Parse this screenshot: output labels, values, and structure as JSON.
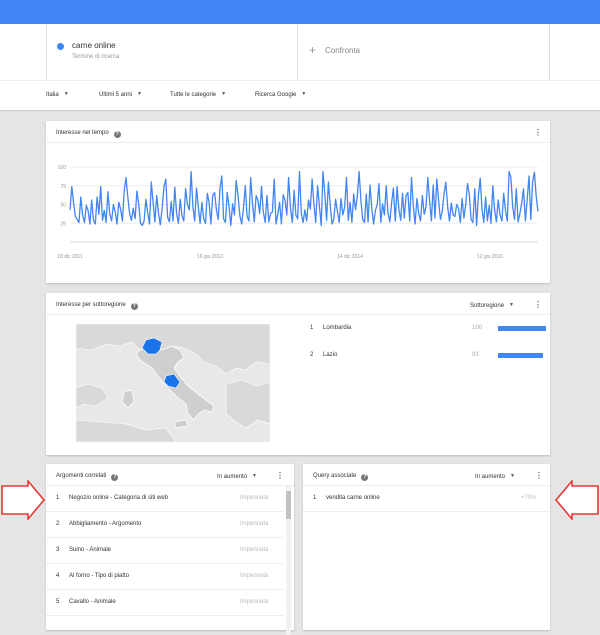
{
  "header": {
    "color": "#4285f4"
  },
  "search": {
    "term": "carne online",
    "term_type": "Termine di ricerca",
    "term_color": "#4285f4",
    "compare_label": "Confronta"
  },
  "filters": [
    {
      "label": "Italia"
    },
    {
      "label": "Ultimi 5 anni"
    },
    {
      "label": "Tutte le categorie"
    },
    {
      "label": "Ricerca Google"
    }
  ],
  "interest_over_time": {
    "title": "Interesse nel tempo",
    "help_icon": "help-icon",
    "menu_icon": "more-vert-icon"
  },
  "chart_data": {
    "type": "line",
    "title": "Interesse nel tempo",
    "xlabel": "",
    "ylabel": "",
    "ylim": [
      0,
      100
    ],
    "yticks": [
      25,
      50,
      75,
      100
    ],
    "x_tick_labels": [
      "18 dic 2011",
      "16 giu 2013",
      "14 dic 2014",
      "12 giu 2016"
    ],
    "grid": true,
    "series": [
      {
        "color": "#4285f4",
        "values": [
          43,
          74,
          52,
          34,
          30,
          26,
          60,
          36,
          26,
          49,
          42,
          24,
          56,
          29,
          24,
          60,
          37,
          74,
          29,
          42,
          26,
          67,
          37,
          28,
          50,
          40,
          24,
          53,
          44,
          28,
          68,
          86,
          60,
          38,
          29,
          45,
          31,
          68,
          51,
          25,
          22,
          28,
          57,
          39,
          24,
          80,
          53,
          27,
          62,
          38,
          23,
          46,
          74,
          84,
          33,
          27,
          54,
          28,
          73,
          38,
          25,
          57,
          35,
          28,
          71,
          50,
          43,
          94,
          47,
          28,
          72,
          47,
          25,
          53,
          31,
          25,
          65,
          53,
          24,
          62,
          66,
          43,
          30,
          71,
          88,
          31,
          26,
          66,
          48,
          22,
          51,
          36,
          82,
          62,
          35,
          24,
          45,
          75,
          34,
          28,
          86,
          51,
          27,
          62,
          56,
          38,
          74,
          40,
          26,
          62,
          27,
          38,
          40,
          84,
          24,
          37,
          53,
          24,
          63,
          56,
          36,
          86,
          46,
          26,
          69,
          36,
          31,
          94,
          38,
          26,
          43,
          28,
          56,
          44,
          84,
          51,
          26,
          75,
          48,
          22,
          94,
          64,
          29,
          80,
          50,
          24,
          30,
          57,
          41,
          26,
          58,
          36,
          47,
          86,
          29,
          53,
          26,
          64,
          43,
          61,
          94,
          56,
          30,
          26,
          64,
          27,
          76,
          45,
          24,
          42,
          50,
          78,
          26,
          51,
          36,
          75,
          39,
          27,
          52,
          72,
          28,
          74,
          43,
          29,
          65,
          32,
          62,
          66,
          28,
          86,
          48,
          24,
          58,
          38,
          28,
          62,
          37,
          47,
          86,
          55,
          28,
          76,
          32,
          84,
          56,
          30,
          40,
          64,
          80,
          46,
          28,
          52,
          36,
          34,
          50,
          45,
          26,
          58,
          32,
          50,
          78,
          64,
          30,
          26,
          71,
          22,
          62,
          85,
          44,
          26,
          60,
          28,
          49,
          25,
          75,
          43,
          27,
          56,
          36,
          28,
          65,
          42,
          28,
          94,
          86,
          47,
          30,
          71,
          27,
          38,
          52,
          71,
          28,
          57,
          88,
          30,
          80,
          93,
          61,
          41
        ]
      }
    ]
  },
  "subregion": {
    "title": "Interesse per sottoregione",
    "dropdown_label": "Sottoregione",
    "highlight_color": "#1a73e8",
    "regions": [
      {
        "rank": "1",
        "name": "Lombardia",
        "value": 100
      },
      {
        "rank": "2",
        "name": "Lazio",
        "value": 93
      }
    ]
  },
  "related_topics": {
    "title": "Argomenti correlati",
    "dropdown_label": "In aumento",
    "items": [
      {
        "rank": "1",
        "label": "Negozio online - Categoria di siti web",
        "value": "Impennata"
      },
      {
        "rank": "2",
        "label": "Abbigliamento - Argomento",
        "value": "Impennata"
      },
      {
        "rank": "3",
        "label": "Suino - Animale",
        "value": "Impennata"
      },
      {
        "rank": "4",
        "label": "Al forno - Tipo di piatto",
        "value": "Impennata"
      },
      {
        "rank": "5",
        "label": "Cavallo - Animale",
        "value": "Impennata"
      }
    ]
  },
  "related_queries": {
    "title": "Query associate",
    "dropdown_label": "In aumento",
    "items": [
      {
        "rank": "1",
        "label": "vendita carne online",
        "value": "+70%"
      }
    ]
  },
  "annotations": {
    "arrow_color": "#e53935"
  }
}
